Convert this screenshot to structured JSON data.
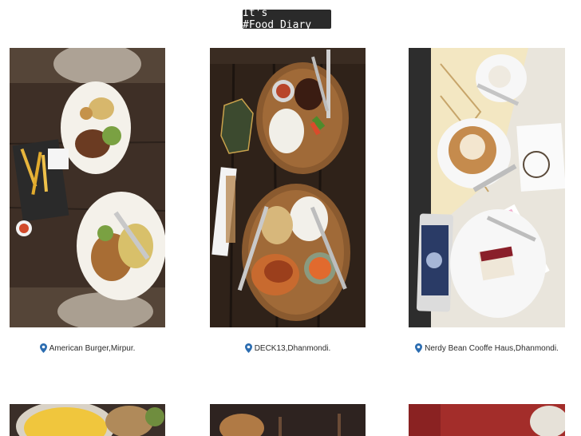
{
  "header": {
    "title": "It's #Food_Diary"
  },
  "gallery": {
    "items": [
      {
        "location": "American Burger,Mirpur."
      },
      {
        "location": "DECK13,Dhanmondi."
      },
      {
        "location": "Nerdy Bean Cooffe Haus,Dhanmondi."
      }
    ]
  },
  "icons": {
    "location": "map-marker-icon"
  },
  "colors": {
    "accent": "#2b6cb0",
    "title_bg": "#2a2a2a"
  }
}
